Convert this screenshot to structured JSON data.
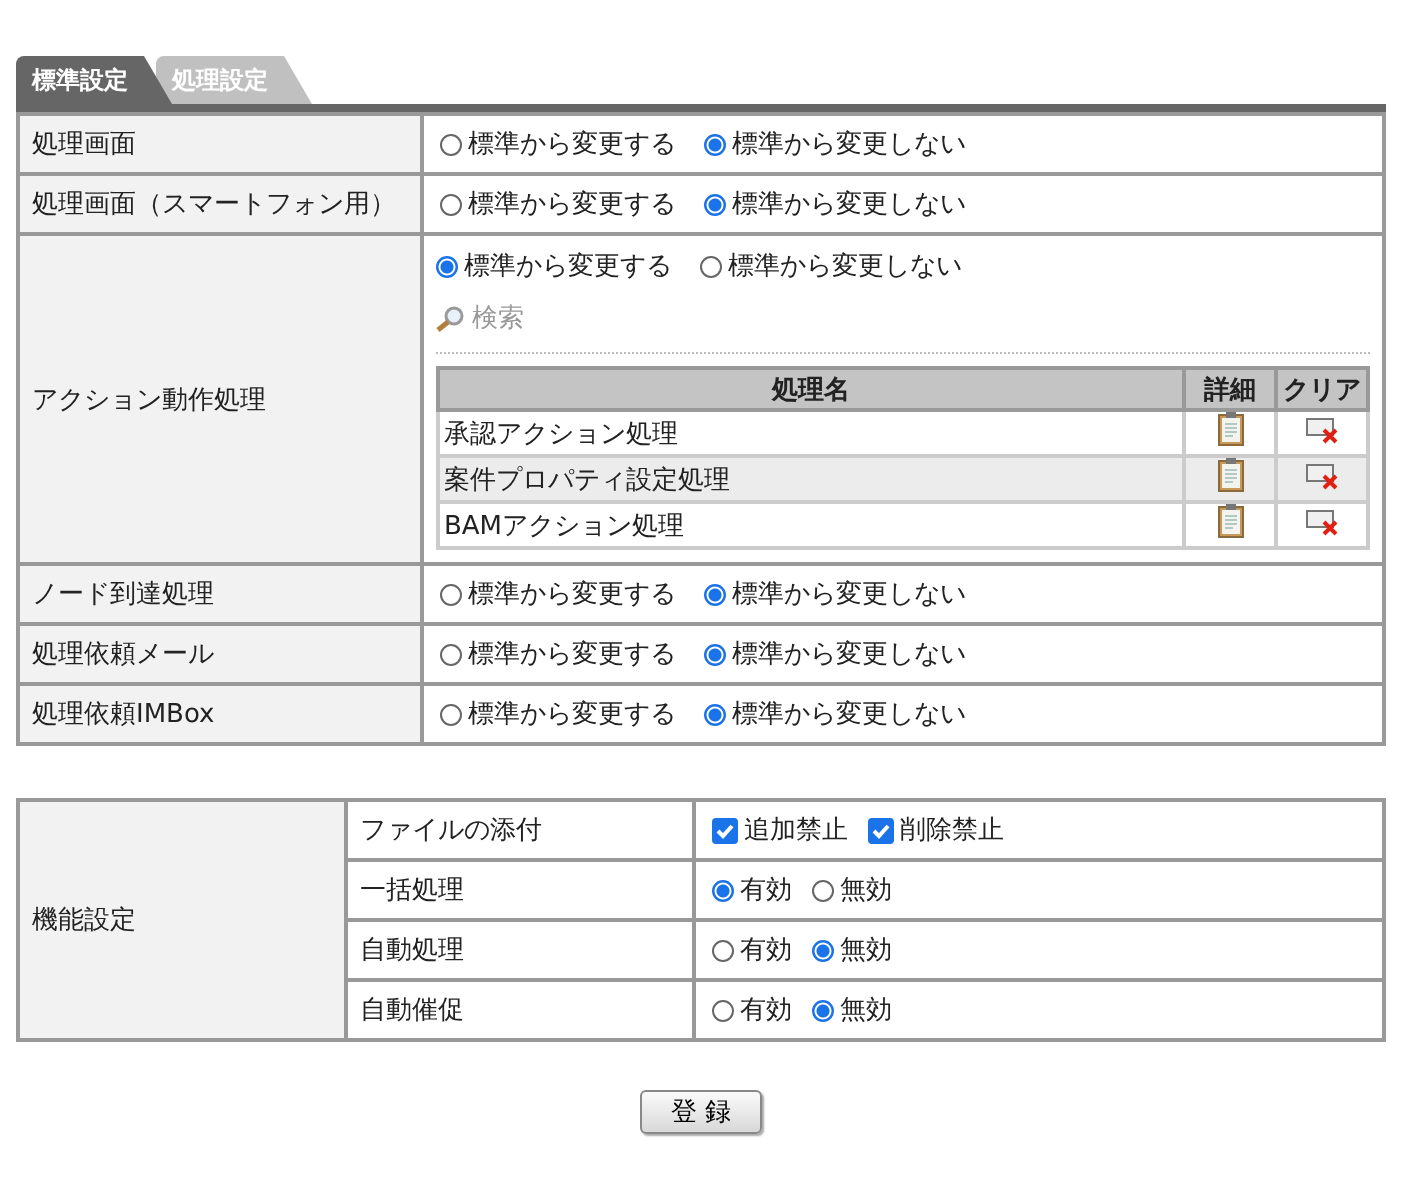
{
  "tabs": [
    {
      "label": "標準設定",
      "selected": true
    },
    {
      "label": "処理設定",
      "selected": false
    }
  ],
  "settings": [
    {
      "kind": "radio",
      "label": "処理画面",
      "options": [
        {
          "label": "標準から変更する",
          "selected": false
        },
        {
          "label": "標準から変更しない",
          "selected": true
        }
      ]
    },
    {
      "kind": "radio",
      "label": "処理画面（スマートフォン用）",
      "options": [
        {
          "label": "標準から変更する",
          "selected": false
        },
        {
          "label": "標準から変更しない",
          "selected": true
        }
      ]
    },
    {
      "kind": "action",
      "label": "アクション動作処理",
      "options": [
        {
          "label": "標準から変更する",
          "selected": true
        },
        {
          "label": "標準から変更しない",
          "selected": false
        }
      ],
      "search": "検索",
      "columns": [
        "処理名",
        "詳細",
        "クリア"
      ],
      "rows": [
        {
          "name": "承認アクション処理"
        },
        {
          "name": "案件プロパティ設定処理"
        },
        {
          "name": "BAMアクション処理"
        }
      ]
    },
    {
      "kind": "radio",
      "label": "ノード到達処理",
      "options": [
        {
          "label": "標準から変更する",
          "selected": false
        },
        {
          "label": "標準から変更しない",
          "selected": true
        }
      ]
    },
    {
      "kind": "radio",
      "label": "処理依頼メール",
      "options": [
        {
          "label": "標準から変更する",
          "selected": false
        },
        {
          "label": "標準から変更しない",
          "selected": true
        }
      ]
    },
    {
      "kind": "radio",
      "label": "処理依頼IMBox",
      "options": [
        {
          "label": "標準から変更する",
          "selected": false
        },
        {
          "label": "標準から変更しない",
          "selected": true
        }
      ]
    }
  ],
  "features": {
    "label": "機能設定",
    "items": [
      {
        "kind": "checkbox",
        "label": "ファイルの添付",
        "options": [
          {
            "label": "追加禁止",
            "checked": true
          },
          {
            "label": "削除禁止",
            "checked": true
          }
        ]
      },
      {
        "kind": "radio",
        "label": "一括処理",
        "options": [
          {
            "label": "有効",
            "selected": true
          },
          {
            "label": "無効",
            "selected": false
          }
        ]
      },
      {
        "kind": "radio",
        "label": "自動処理",
        "options": [
          {
            "label": "有効",
            "selected": false
          },
          {
            "label": "無効",
            "selected": true
          }
        ]
      },
      {
        "kind": "radio",
        "label": "自動催促",
        "options": [
          {
            "label": "有効",
            "selected": false
          },
          {
            "label": "無効",
            "selected": true
          }
        ]
      }
    ]
  },
  "register_button": "登 録"
}
